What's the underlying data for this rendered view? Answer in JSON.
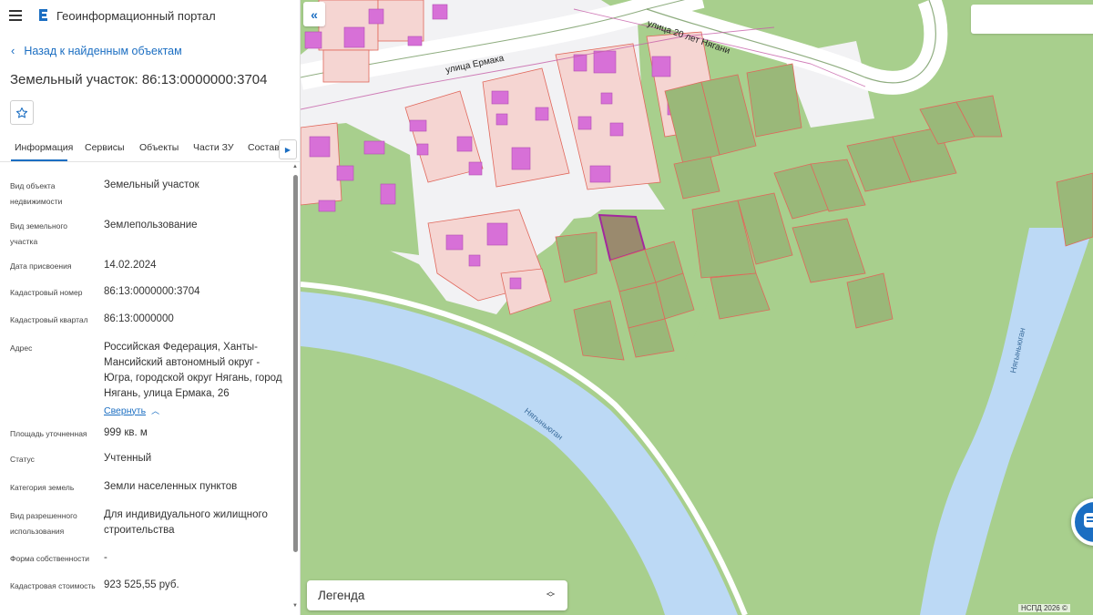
{
  "header": {
    "title": "Геоинформационный портал"
  },
  "nav": {
    "back_label": "Назад к найденным объектам"
  },
  "parcel": {
    "title": "Земельный участок: 86:13:0000000:3704"
  },
  "tabs": [
    {
      "label": "Информация"
    },
    {
      "label": "Сервисы"
    },
    {
      "label": "Объекты"
    },
    {
      "label": "Части ЗУ"
    },
    {
      "label": "Состав"
    }
  ],
  "info": {
    "object_type": {
      "label": "Вид объекта недвижимости",
      "value": "Земельный участок"
    },
    "land_type": {
      "label": "Вид земельного участка",
      "value": "Землепользование"
    },
    "assign_date": {
      "label": "Дата присвоения",
      "value": "14.02.2024"
    },
    "cad_number": {
      "label": "Кадастровый номер",
      "value": "86:13:0000000:3704"
    },
    "cad_quarter": {
      "label": "Кадастровый квартал",
      "value": "86:13:0000000"
    },
    "address": {
      "label": "Адрес",
      "value": "Российская Федерация, Ханты-Мансийский автономный округ - Югра, городской округ Нягань, город Нягань, улица Ермака, 26",
      "collapse": "Свернуть"
    },
    "area": {
      "label": "Площадь уточненная",
      "value": "999 кв. м"
    },
    "status": {
      "label": "Статус",
      "value": "Учтенный"
    },
    "category": {
      "label": "Категория земель",
      "value": "Земли населенных пунктов"
    },
    "permitted_use": {
      "label": "Вид разрешенного использования",
      "value": "Для индивидуального жилищного строительства"
    },
    "ownership": {
      "label": "Форма собственности",
      "value": "-"
    },
    "cad_cost": {
      "label": "Кадастровая стоимость",
      "value": "923 525,55 руб."
    }
  },
  "map": {
    "street_1": "улица Ермака",
    "street_2": "улица 20 лет Нягани",
    "river_1": "Нягыньюган",
    "river_2": "Нягыньюган",
    "legend_label": "Легенда",
    "copyright": "НСПД 2026 ©"
  },
  "colors": {
    "accent": "#1b6ec2",
    "grass": "#a8cf8d",
    "water": "#bcd9f5",
    "parcel_fill": "#f5d5d2",
    "building": "#d770d7"
  }
}
